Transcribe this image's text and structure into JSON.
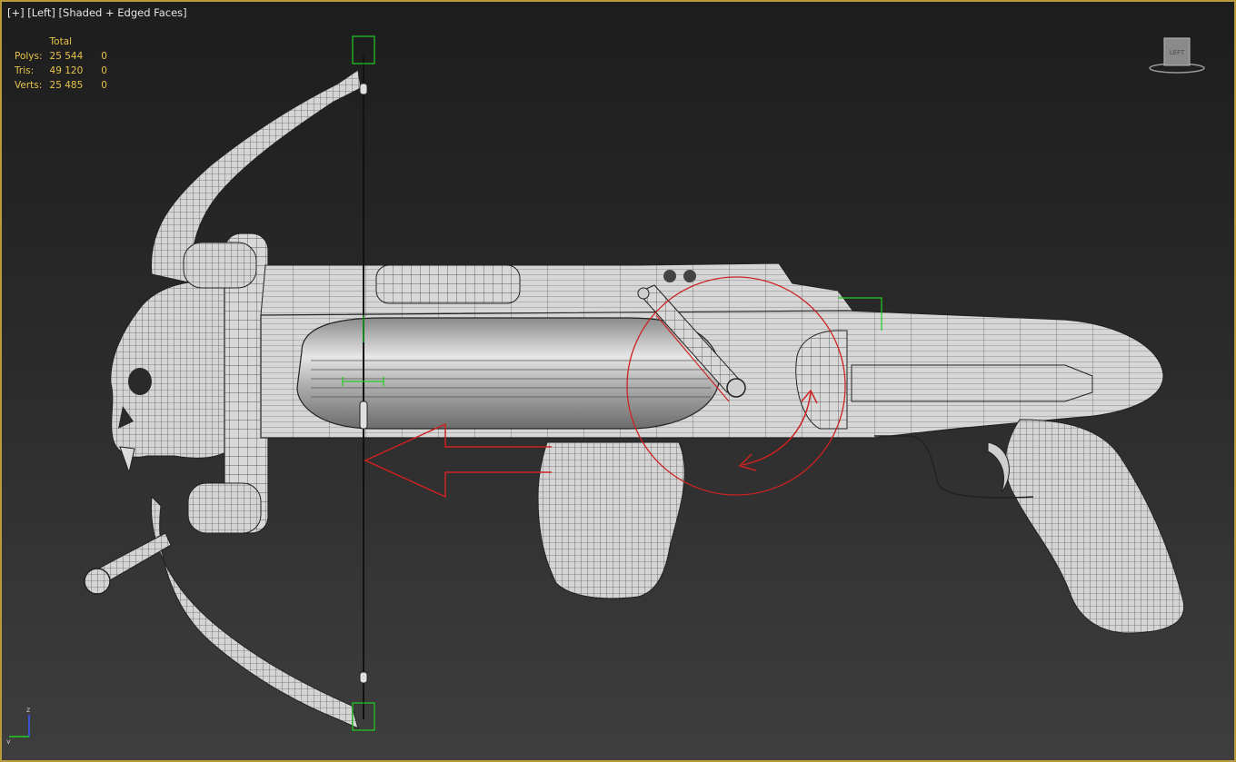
{
  "viewport": {
    "label_parts": [
      "[+]",
      "[Left]",
      "[Shaded + Edged Faces]"
    ],
    "frame_color": "#b89a3c",
    "background_top": "#1d1d1d",
    "background_bottom": "#3e3e3e"
  },
  "stats": {
    "header": "Total",
    "rows": [
      {
        "label": "Polys:",
        "total": "25 544",
        "selected": "0"
      },
      {
        "label": "Tris:",
        "total": "49 120",
        "selected": "0"
      },
      {
        "label": "Verts:",
        "total": "25 485",
        "selected": "0"
      }
    ],
    "color": "#e7c34a"
  },
  "viewcube": {
    "face_label": "LEFT"
  },
  "axis_tripod": {
    "vertical": "z",
    "horizontal": "y"
  },
  "model": {
    "description_icon": "crossbow-mesh",
    "annotation_color": "#cc2222",
    "gizmo_color": "#22cc22"
  }
}
